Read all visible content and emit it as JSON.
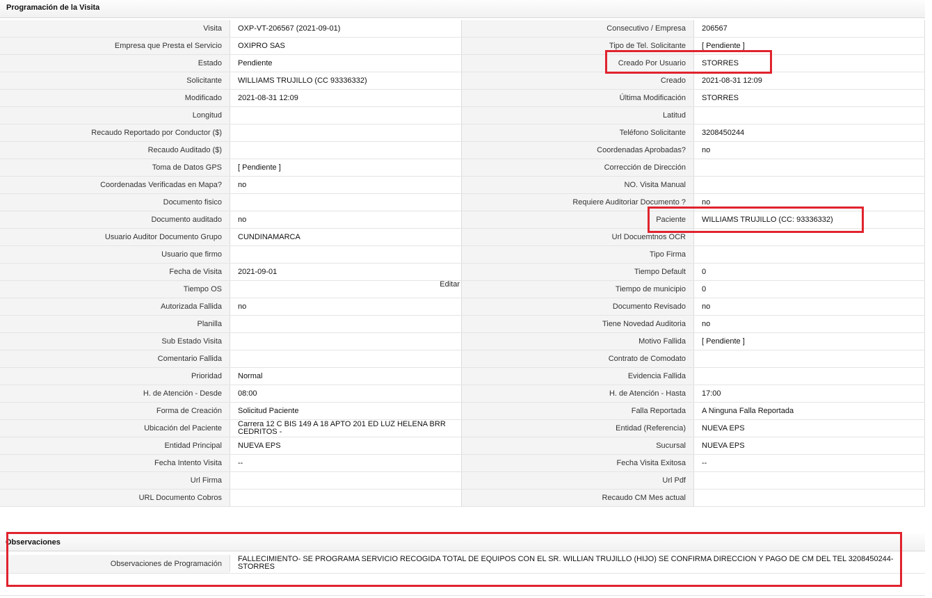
{
  "section_title": "Programación de la Visita",
  "rows": [
    {
      "l1": "Visita",
      "v1": "OXP-VT-206567 (2021-09-01)",
      "l2": "Consecutivo / Empresa",
      "v2": "206567"
    },
    {
      "l1": "Empresa que Presta el Servicio",
      "v1": "OXIPRO SAS",
      "l2": "Tipo de Tel. Solicitante",
      "v2": "[ Pendiente ]"
    },
    {
      "l1": "Estado",
      "v1": "Pendiente",
      "l2": "Creado Por Usuario",
      "v2": "STORRES"
    },
    {
      "l1": "Solicitante",
      "v1": "WILLIAMS TRUJILLO (CC 93336332)",
      "l2": "Creado",
      "v2": "2021-08-31 12:09"
    },
    {
      "l1": "Modificado",
      "v1": "2021-08-31 12:09",
      "l2": "Última Modificación",
      "v2": " STORRES"
    },
    {
      "l1": "Longitud",
      "v1": "",
      "l2": "Latitud",
      "v2": ""
    },
    {
      "l1": "Recaudo Reportado por Conductor ($)",
      "v1": "",
      "l2": "Teléfono Solicitante",
      "v2": "3208450244"
    },
    {
      "l1": "Recaudo Auditado ($)",
      "v1": "",
      "l2": "Coordenadas Aprobadas?",
      "v2": " no"
    },
    {
      "l1": "Toma de Datos GPS",
      "v1": "[ Pendiente ]",
      "l2": "Corrección de Dirección",
      "v2": ""
    },
    {
      "l1": "Coordenadas Verificadas en Mapa?",
      "v1": " no",
      "l2": "NO. Visita Manual",
      "v2": ""
    },
    {
      "l1": "Documento fisico",
      "v1": "",
      "l2": "Requiere Auditoriar Documento ?",
      "v2": " no"
    },
    {
      "l1": "Documento auditado",
      "v1": " no",
      "l2": "Paciente",
      "v2": "WILLIAMS TRUJILLO (CC: 93336332)"
    },
    {
      "l1": "Usuario Auditor Documento Grupo",
      "v1": "CUNDINAMARCA",
      "l2": "Url Docuemtnos OCR",
      "v2": ""
    },
    {
      "l1": "Usuario que firmo",
      "v1": "",
      "l2": "Tipo Firma",
      "v2": ""
    },
    {
      "l1": "Fecha de Visita",
      "v1": " 2021-09-01",
      "l2": "Tiempo Default",
      "v2": "0"
    },
    {
      "l1": "Tiempo OS",
      "v1": "",
      "l2": "Tiempo de municipio",
      "v2": "0"
    },
    {
      "l1": "Autorizada Fallida",
      "v1": " no",
      "l2": "Documento Revisado",
      "v2": " no"
    },
    {
      "l1": "Planilla",
      "v1": "",
      "l2": "Tiene Novedad Auditoria",
      "v2": " no"
    },
    {
      "l1": "Sub Estado Visita",
      "v1": "",
      "l2": "Motivo Fallida",
      "v2": "[ Pendiente ]"
    },
    {
      "l1": "Comentario Fallida",
      "v1": "",
      "l2": "Contrato de Comodato",
      "v2": ""
    },
    {
      "l1": "Prioridad",
      "v1": "Normal",
      "l2": "Evidencia Fallida",
      "v2": ""
    },
    {
      "l1": "H. de Atención - Desde",
      "v1": "08:00",
      "l2": "H. de Atención - Hasta",
      "v2": "17:00"
    },
    {
      "l1": "Forma de Creación",
      "v1": "Solicitud Paciente",
      "l2": "Falla Reportada",
      "v2": "A Ninguna Falla Reportada"
    },
    {
      "l1": "Ubicación del Paciente",
      "v1": "Carrera 12 C BIS 149 A 18 APTO 201 ED LUZ HELENA BRR CEDRITOS -",
      "l2": "Entidad (Referencia)",
      "v2": "NUEVA EPS"
    },
    {
      "l1": "Entidad Principal",
      "v1": "NUEVA EPS",
      "l2": "Sucursal",
      "v2": "NUEVA EPS"
    },
    {
      "l1": "Fecha Intento Visita",
      "v1": " --",
      "l2": "Fecha Visita Exitosa",
      "v2": " --"
    },
    {
      "l1": "Url Firma",
      "v1": "",
      "l2": "Url Pdf",
      "v2": ""
    },
    {
      "l1": "URL Documento Cobros",
      "v1": "",
      "l2": "Recaudo CM Mes actual",
      "v2": ""
    }
  ],
  "editar_label": "Editar",
  "observaciones": {
    "title": "Observaciones",
    "label": "Observaciones de Programación",
    "value": "  FALLECIMIENTO- SE PROGRAMA SERVICIO RECOGIDA TOTAL DE EQUIPOS CON EL SR. WILLIAN TRUJILLO (HIJO) SE CONFIRMA DIRECCION Y PAGO DE CM DEL TEL 3208450244-STORRES"
  },
  "highlight_color": "#e0232e"
}
